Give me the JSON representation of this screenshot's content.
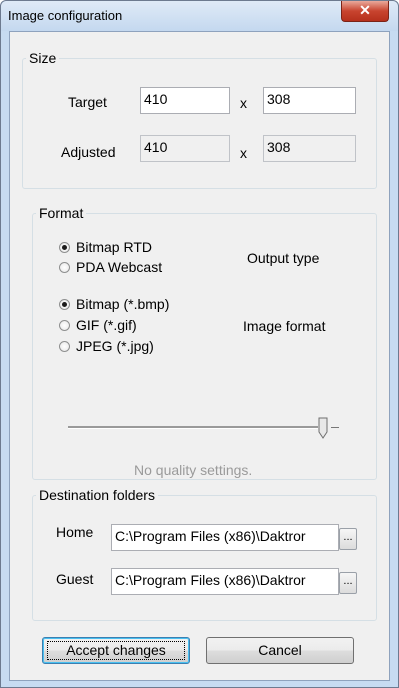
{
  "window": {
    "title": "Image configuration",
    "close_glyph": "✕"
  },
  "size": {
    "legend": "Size",
    "target_label": "Target",
    "target_width": "410",
    "target_height": "308",
    "adjusted_label": "Adjusted",
    "adjusted_width": "410",
    "adjusted_height": "308",
    "times": "x"
  },
  "format": {
    "legend": "Format",
    "output_type_label": "Output type",
    "output_options": [
      {
        "label": "Bitmap RTD",
        "selected": true
      },
      {
        "label": "PDA Webcast",
        "selected": false
      }
    ],
    "image_format_label": "Image format",
    "image_options": [
      {
        "label": "Bitmap (*.bmp)",
        "selected": true
      },
      {
        "label": "GIF (*.gif)",
        "selected": false
      },
      {
        "label": "JPEG (*.jpg)",
        "selected": false
      }
    ],
    "quality_level": 1.0,
    "quality_text": "No quality settings."
  },
  "destinations": {
    "legend": "Destination folders",
    "home_label": "Home",
    "home_path": "C:\\Program Files (x86)\\Daktror",
    "guest_label": "Guest",
    "guest_path": "C:\\Program Files (x86)\\Daktror",
    "browse_label": "..."
  },
  "buttons": {
    "accept": "Accept changes",
    "cancel": "Cancel"
  }
}
